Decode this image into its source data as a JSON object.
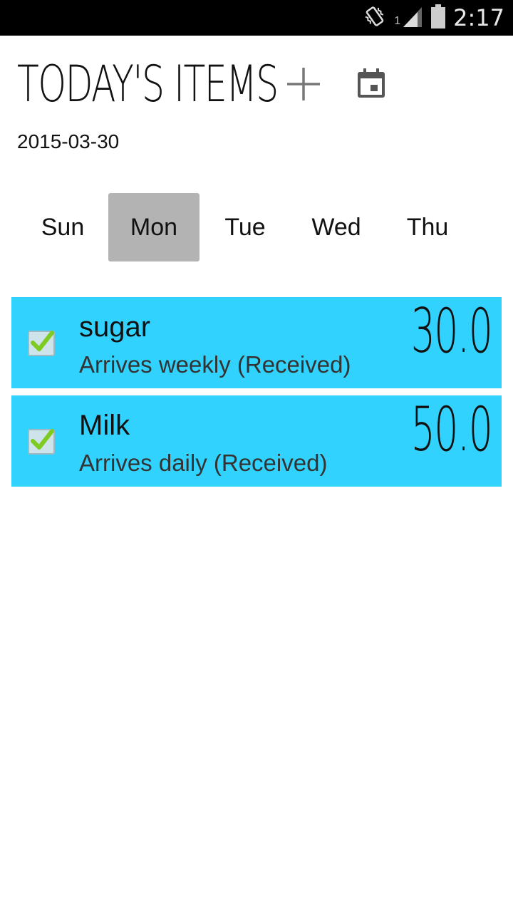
{
  "status_bar": {
    "time": "2:17",
    "sim_number": "1",
    "icons": [
      "vibrate-icon",
      "signal-icon",
      "battery-icon"
    ]
  },
  "header": {
    "title": "TODAY'S ITEMS",
    "add_icon": "plus-icon",
    "calendar_icon": "calendar-icon"
  },
  "date": "2015-03-30",
  "days": [
    {
      "label": "Sun",
      "selected": false
    },
    {
      "label": "Mon",
      "selected": true
    },
    {
      "label": "Tue",
      "selected": false
    },
    {
      "label": "Wed",
      "selected": false
    },
    {
      "label": "Thu",
      "selected": false
    }
  ],
  "items": [
    {
      "name": "sugar",
      "subtitle": "Arrives weekly (Received)",
      "price": "30.0",
      "checked": true
    },
    {
      "name": "Milk",
      "subtitle": "Arrives daily (Received)",
      "price": "50.0",
      "checked": true
    }
  ],
  "colors": {
    "item_background": "#31d3fe",
    "selected_day": "#b3b3b3",
    "status_bar": "#000000"
  }
}
